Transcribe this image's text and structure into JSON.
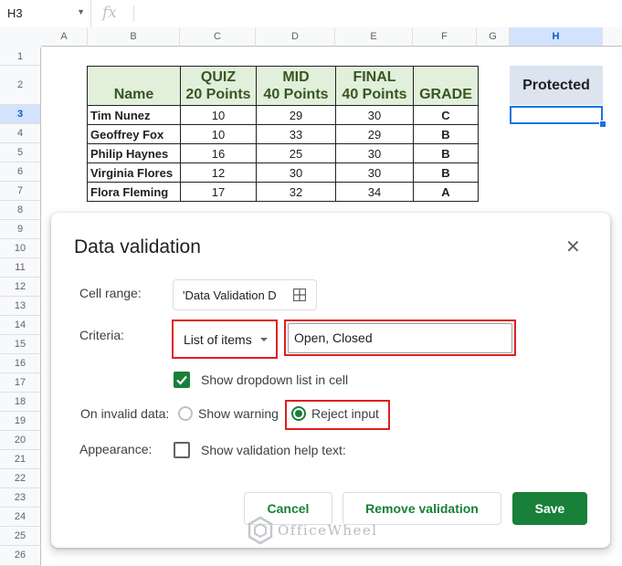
{
  "formula_bar": {
    "name_box": "H3",
    "fx": "fx"
  },
  "columns": [
    "A",
    "B",
    "C",
    "D",
    "E",
    "F",
    "G",
    "H"
  ],
  "rows": [
    "1",
    "2",
    "3",
    "4",
    "5",
    "6",
    "7",
    "8",
    "9",
    "10",
    "11",
    "12",
    "13",
    "14",
    "15",
    "16",
    "17",
    "18",
    "19",
    "20",
    "21",
    "22",
    "23",
    "24",
    "25",
    "26"
  ],
  "table": {
    "headers": [
      {
        "line1": "",
        "line2": "Name"
      },
      {
        "line1": "QUIZ",
        "line2": "20 Points"
      },
      {
        "line1": "MID",
        "line2": "40 Points"
      },
      {
        "line1": "FINAL",
        "line2": "40 Points"
      },
      {
        "line1": "",
        "line2": "GRADE"
      }
    ],
    "rows": [
      [
        "Tim Nunez",
        "10",
        "29",
        "30",
        "C"
      ],
      [
        "Geoffrey Fox",
        "10",
        "33",
        "29",
        "B"
      ],
      [
        "Philip Haynes",
        "16",
        "25",
        "30",
        "B"
      ],
      [
        "Virginia Flores",
        "12",
        "30",
        "30",
        "B"
      ],
      [
        "Flora Fleming",
        "17",
        "32",
        "34",
        "A"
      ]
    ]
  },
  "protected_header": "Protected",
  "dialog": {
    "title": "Data validation",
    "cell_range_label": "Cell range:",
    "cell_range_value": "'Data Validation D",
    "criteria_label": "Criteria:",
    "criteria_value": "List of items",
    "items_value": "Open, Closed",
    "show_dropdown_label": "Show dropdown list in cell",
    "on_invalid_label": "On invalid data:",
    "show_warning_label": "Show warning",
    "reject_input_label": "Reject input",
    "appearance_label": "Appearance:",
    "help_text_label": "Show validation help text:",
    "cancel_label": "Cancel",
    "remove_label": "Remove validation",
    "save_label": "Save"
  },
  "watermark": "OfficeWheel",
  "colors": {
    "accent_green": "#188038",
    "highlight_red": "#e01e1e",
    "header_green": "#e2efda",
    "selection_blue": "#1a73e8"
  }
}
